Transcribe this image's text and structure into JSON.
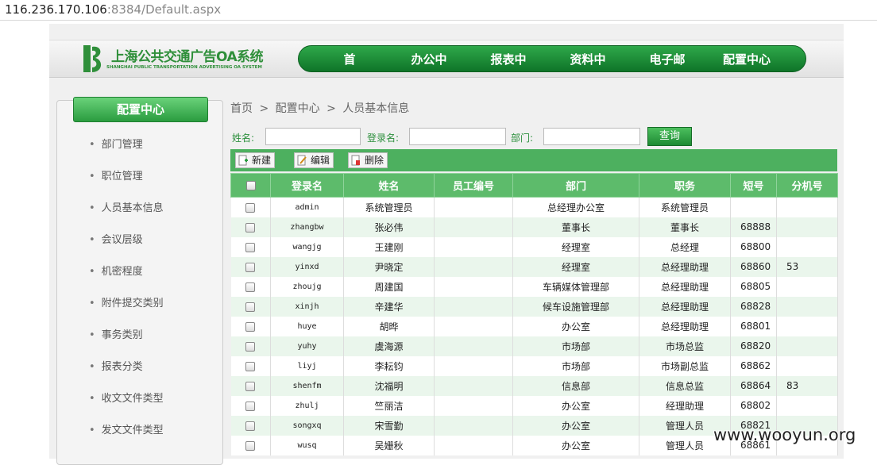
{
  "browser": {
    "host": "116.236.170.106",
    "port_path": ":8384/Default.aspx"
  },
  "brand": {
    "title": "上海公共交通广告OA系统",
    "subtitle": "SHANGHAI PUBLIC TRANSPORTATION ADVERTISING OA SYSTEM",
    "color": "#2f8f3a"
  },
  "nav": {
    "items": [
      "首",
      "办公中",
      "报表中",
      "资料中",
      "电子邮",
      "配置中心"
    ]
  },
  "sidebar": {
    "header": "配置中心",
    "items": [
      "部门管理",
      "职位管理",
      "人员基本信息",
      "会议层级",
      "机密程度",
      "附件提交类别",
      "事务类别",
      "报表分类",
      "收文文件类型",
      "发文文件类型"
    ]
  },
  "breadcrumb": {
    "home": "首页",
    "sep": ">",
    "section": "配置中心",
    "current": "人员基本信息"
  },
  "search": {
    "name_label": "姓名:",
    "login_label": "登录名:",
    "dept_label": "部门:",
    "query_button": "查询"
  },
  "toolbar": {
    "new": "新建",
    "edit": "编辑",
    "delete": "删除"
  },
  "table": {
    "columns": [
      "登录名",
      "姓名",
      "员工编号",
      "部门",
      "职务",
      "短号",
      "分机号"
    ],
    "rows": [
      [
        "admin",
        "系统管理员",
        "",
        "总经理办公室",
        "系统管理员",
        "",
        ""
      ],
      [
        "zhangbw",
        "张必伟",
        "",
        "董事长",
        "董事长",
        "68888",
        ""
      ],
      [
        "wangjg",
        "王建刚",
        "",
        "经理室",
        "总经理",
        "68800",
        ""
      ],
      [
        "yinxd",
        "尹晓定",
        "",
        "经理室",
        "总经理助理",
        "68860",
        "53"
      ],
      [
        "zhoujg",
        "周建国",
        "",
        "车辆媒体管理部",
        "总经理助理",
        "68805",
        ""
      ],
      [
        "xinjh",
        "辛建华",
        "",
        "候车设施管理部",
        "总经理助理",
        "68828",
        ""
      ],
      [
        "huye",
        "胡晔",
        "",
        "办公室",
        "总经理助理",
        "68801",
        ""
      ],
      [
        "yuhy",
        "虞海源",
        "",
        "市场部",
        "市场总监",
        "68820",
        ""
      ],
      [
        "liyj",
        "李耘钧",
        "",
        "市场部",
        "市场副总监",
        "68862",
        ""
      ],
      [
        "shenfm",
        "沈福明",
        "",
        "信息部",
        "信息总监",
        "68864",
        "83"
      ],
      [
        "zhulj",
        "竺丽洁",
        "",
        "办公室",
        "经理助理",
        "68802",
        ""
      ],
      [
        "songxq",
        "宋雪勤",
        "",
        "办公室",
        "管理人员",
        "68821",
        ""
      ],
      [
        "wusq",
        "吴姗秋",
        "",
        "办公室",
        "管理人员",
        "68861",
        ""
      ]
    ]
  },
  "watermark": "www.wooyun.org",
  "colors": {
    "accent": "#4db05f",
    "nav_dark": "#0f7428",
    "row_alt": "#eaf6ec"
  }
}
